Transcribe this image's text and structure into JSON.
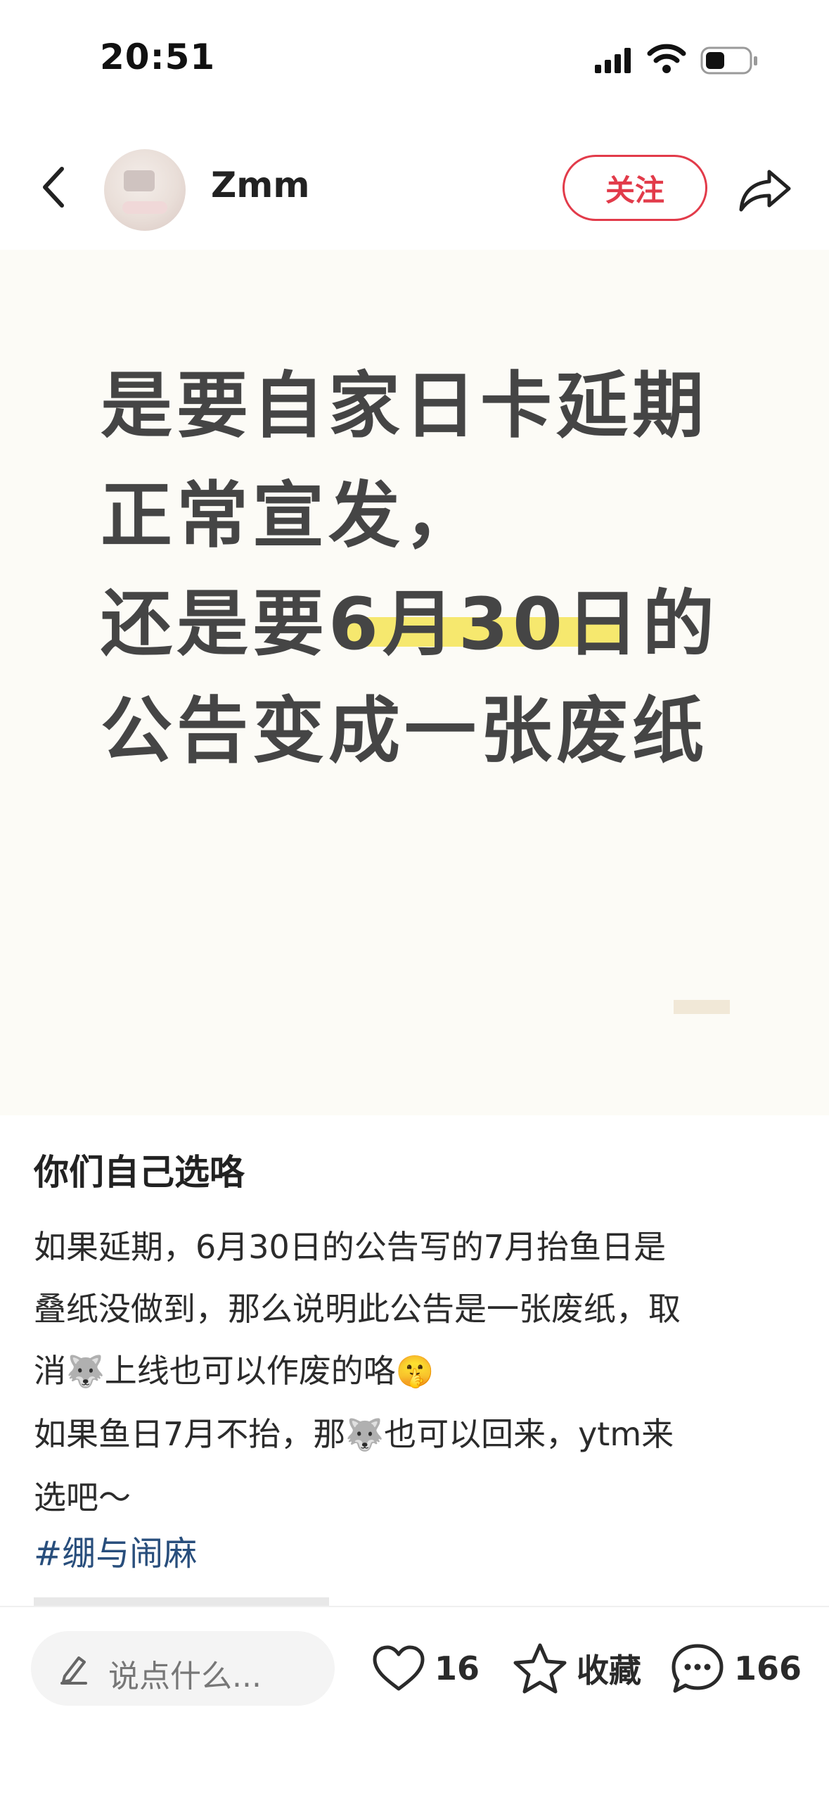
{
  "status_bar": {
    "time": "20:51"
  },
  "header": {
    "username": "Zmm",
    "follow_label": "关注"
  },
  "post_image": {
    "line1": "是要自家日卡延期",
    "line2": "正常宣发，",
    "line3_before": "还是要",
    "line3_highlight": "6月30日",
    "line3_after": "的",
    "line4": "公告变成一张废纸"
  },
  "post": {
    "title": "你们自己选咯",
    "line1": "如果延期，6月30日的公告写的7月抬鱼日是",
    "line2": "叠纸没做到，那么说明此公告是一张废纸，取",
    "line3_a": "消",
    "line3_b": "上线也可以作废的咯",
    "line4_a": "如果鱼日7月不抬，那",
    "line4_b": "也可以回来，ytm来",
    "line5": "选吧～",
    "hashtag": "#绷与闹麻"
  },
  "bottom_bar": {
    "comment_placeholder": "说点什么...",
    "likes": "16",
    "favorite_label": "收藏",
    "comments": "166"
  },
  "colors": {
    "accent": "#e23b4a",
    "highlight": "#f6e86e",
    "hashtag": "#284e7c",
    "image_bg": "#fcfbf6"
  }
}
